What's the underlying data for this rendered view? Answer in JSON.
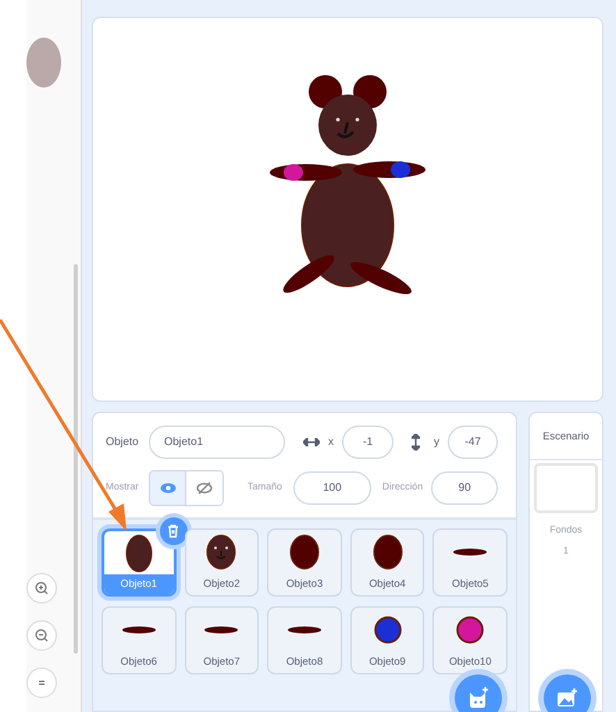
{
  "sprite_info": {
    "name_label": "Objeto",
    "name_value": "Objeto1",
    "x_label": "x",
    "x_value": "-1",
    "y_label": "y",
    "y_value": "-47",
    "show_label": "Mostrar",
    "visible": true,
    "size_label": "Tamaño",
    "size_value": "100",
    "direction_label": "Dirección",
    "direction_value": "90"
  },
  "sprites": [
    {
      "name": "Objeto1",
      "kind": "body",
      "color": "#4a2020",
      "selected": true
    },
    {
      "name": "Objeto2",
      "kind": "head",
      "color": "#4a2020",
      "selected": false
    },
    {
      "name": "Objeto3",
      "kind": "oval",
      "color": "#520000",
      "selected": false
    },
    {
      "name": "Objeto4",
      "kind": "oval",
      "color": "#520000",
      "selected": false
    },
    {
      "name": "Objeto5",
      "kind": "flat",
      "color": "#520000",
      "selected": false
    },
    {
      "name": "Objeto6",
      "kind": "flat",
      "color": "#520000",
      "selected": false
    },
    {
      "name": "Objeto7",
      "kind": "flat",
      "color": "#520000",
      "selected": false
    },
    {
      "name": "Objeto8",
      "kind": "flat",
      "color": "#520000",
      "selected": false
    },
    {
      "name": "Objeto9",
      "kind": "dot",
      "color": "#1a2fd6",
      "selected": false
    },
    {
      "name": "Objeto10",
      "kind": "dot",
      "color": "#d4169c",
      "selected": false
    }
  ],
  "stage_panel": {
    "title": "Escenario",
    "backdrops_label": "Fondos",
    "backdrops_count": "1"
  }
}
